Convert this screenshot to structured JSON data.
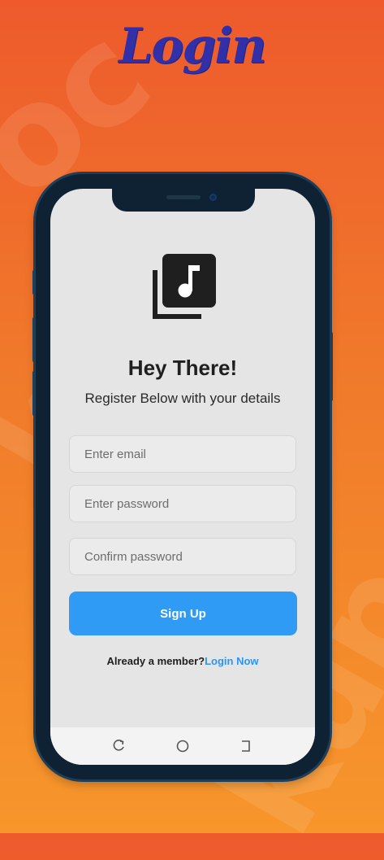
{
  "header": {
    "title": "Login"
  },
  "screen": {
    "greeting": "Hey There!",
    "subtitle": "Register Below with your details",
    "fields": {
      "email_placeholder": "Enter email",
      "password_placeholder": "Enter password",
      "confirm_placeholder": "Confirm password"
    },
    "signup_label": "Sign Up",
    "member_prompt": "Already a member?",
    "login_link": "Login Now"
  },
  "icons": {
    "app": "music-library-icon",
    "nav": [
      "recent-apps-icon",
      "home-icon",
      "back-icon"
    ]
  },
  "colors": {
    "background_top": "#ee5a2c",
    "background_bottom": "#f7962b",
    "title": "#3230a8",
    "primary_button": "#2f9bf5",
    "link": "#2f94ef",
    "screen_bg": "#e5e5e5",
    "phone_frame": "#0e2233"
  }
}
